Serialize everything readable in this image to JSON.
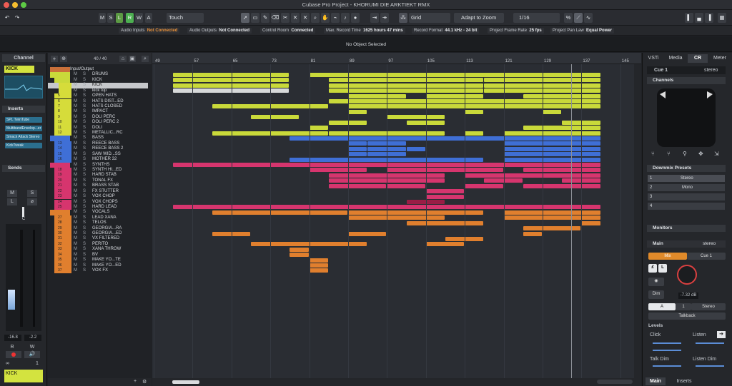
{
  "window": {
    "title": "Cubase Pro Project - KHORUMI DIE ARKTIEKT RMX"
  },
  "toolbar": {
    "m": "M",
    "s": "S",
    "l": "L",
    "r": "R",
    "w": "W",
    "a": "A",
    "automation_mode": "Touch",
    "snap_type": "Grid",
    "adapt_mode": "Adapt to Zoom",
    "quantize": "1/16"
  },
  "status": [
    {
      "label": "Audio Inputs",
      "value": "Not Connected",
      "warn": true
    },
    {
      "label": "Audio Outputs",
      "value": "Not Connected",
      "warn": false
    },
    {
      "label": "Control Room",
      "value": "Connected",
      "warn": false
    },
    {
      "label": "Max. Record Time",
      "value": "1625 hours 47 mins",
      "warn": false
    },
    {
      "label": "Record Format",
      "value": "44.1 kHz - 24 bit",
      "warn": false
    },
    {
      "label": "Project Frame Rate",
      "value": "25 fps",
      "warn": false
    },
    {
      "label": "Project Pan Law",
      "value": "Equal Power",
      "warn": false
    }
  ],
  "infoline": "No Object Selected",
  "inspector": {
    "tab": "Channel",
    "track_name": "KICK",
    "inserts_label": "Inserts",
    "inserts": [
      "SPL TwinTube",
      "MultibandEnvelop...er",
      "Smack Attack Stereo",
      "KickTweak"
    ],
    "sends_label": "Sends",
    "fader_value": "-16.8",
    "pan_value": "-2.2",
    "bottom_name": "KICK",
    "bottom_num": "1",
    "btn_m": "M",
    "btn_s": "S",
    "btn_l": "L",
    "btn_r": "R",
    "btn_w": "W",
    "pan_c": "C"
  },
  "tracklist": {
    "count": "40 / 40",
    "tracks": [
      {
        "name": "Input/Output",
        "num": "",
        "color": "#c9703a",
        "indent": 0,
        "folder": true,
        "ms": false
      },
      {
        "name": "DRUMS",
        "num": "",
        "color": "#c9d93a",
        "indent": 0,
        "folder": true,
        "ms": true
      },
      {
        "name": "KICK",
        "num": "",
        "color": "#c9d93a",
        "indent": 1,
        "folder": true,
        "ms": true
      },
      {
        "name": "KICK",
        "num": "",
        "color": "#d6dc3a",
        "indent": 2,
        "folder": false,
        "ms": true,
        "selected": true
      },
      {
        "name": "kick top",
        "num": "",
        "color": "#d6dc3a",
        "indent": 2,
        "folder": false,
        "ms": true
      },
      {
        "name": "OPEN HATS",
        "num": "5",
        "color": "#d6dc3a",
        "indent": 1,
        "folder": false,
        "ms": true
      },
      {
        "name": "HATS DIST...ED",
        "num": "6",
        "color": "#d6dc3a",
        "indent": 1,
        "folder": false,
        "ms": true
      },
      {
        "name": "HATS CLOSED",
        "num": "7",
        "color": "#d6dc3a",
        "indent": 1,
        "folder": false,
        "ms": true
      },
      {
        "name": "IMPACT",
        "num": "8",
        "color": "#d6dc3a",
        "indent": 1,
        "folder": false,
        "ms": true
      },
      {
        "name": "DOLI PERC",
        "num": "9",
        "color": "#d6dc3a",
        "indent": 1,
        "folder": false,
        "ms": true
      },
      {
        "name": "DOLI PERC 2",
        "num": "10",
        "color": "#d6dc3a",
        "indent": 1,
        "folder": false,
        "ms": true
      },
      {
        "name": "DOLI",
        "num": "11",
        "color": "#d6dc3a",
        "indent": 1,
        "folder": false,
        "ms": true
      },
      {
        "name": "METALLIC...RC",
        "num": "12",
        "color": "#d6dc3a",
        "indent": 1,
        "folder": false,
        "ms": true
      },
      {
        "name": "BASS",
        "num": "",
        "color": "#3f6fd6",
        "indent": 0,
        "folder": true,
        "ms": true
      },
      {
        "name": "REECE BASS",
        "num": "13",
        "color": "#3f6fd6",
        "indent": 1,
        "folder": false,
        "ms": true
      },
      {
        "name": "REECE BASS 2",
        "num": "14",
        "color": "#3f6fd6",
        "indent": 1,
        "folder": false,
        "ms": true
      },
      {
        "name": "SAW WID...SS",
        "num": "15",
        "color": "#3f6fd6",
        "indent": 1,
        "folder": false,
        "ms": true
      },
      {
        "name": "MOTHER 32",
        "num": "16",
        "color": "#3f6fd6",
        "indent": 1,
        "folder": false,
        "ms": true
      },
      {
        "name": "SYNTHS",
        "num": "",
        "color": "#d6356e",
        "indent": 0,
        "folder": true,
        "ms": true
      },
      {
        "name": "SYNTH HI...ED",
        "num": "18",
        "color": "#d6356e",
        "indent": 1,
        "folder": false,
        "ms": true
      },
      {
        "name": "HARD STAB",
        "num": "19",
        "color": "#d6356e",
        "indent": 1,
        "folder": false,
        "ms": true
      },
      {
        "name": "TONAL FX",
        "num": "20",
        "color": "#d6356e",
        "indent": 1,
        "folder": false,
        "ms": true
      },
      {
        "name": "BRASS STAB",
        "num": "21",
        "color": "#d6356e",
        "indent": 1,
        "folder": false,
        "ms": true
      },
      {
        "name": "FX STUTTER",
        "num": "22",
        "color": "#d6356e",
        "indent": 1,
        "folder": false,
        "ms": true
      },
      {
        "name": "VOX CHOP",
        "num": "23",
        "color": "#d6356e",
        "indent": 1,
        "folder": false,
        "ms": true
      },
      {
        "name": "VOX CHOPS",
        "num": "24",
        "color": "#d6356e",
        "indent": 1,
        "folder": false,
        "ms": true
      },
      {
        "name": "HARD LEAD",
        "num": "25",
        "color": "#d6356e",
        "indent": 1,
        "folder": false,
        "ms": true
      },
      {
        "name": "VOCALS",
        "num": "",
        "color": "#e07f2e",
        "indent": 0,
        "folder": true,
        "ms": true
      },
      {
        "name": "LEAD XANA",
        "num": "27",
        "color": "#e07f2e",
        "indent": 1,
        "folder": false,
        "ms": true
      },
      {
        "name": "TELOS",
        "num": "28",
        "color": "#e07f2e",
        "indent": 1,
        "folder": false,
        "ms": true
      },
      {
        "name": "GEORGIA...RA",
        "num": "29",
        "color": "#e07f2e",
        "indent": 1,
        "folder": false,
        "ms": true
      },
      {
        "name": "GEORGIA...ED",
        "num": "30",
        "color": "#e07f2e",
        "indent": 1,
        "folder": false,
        "ms": true
      },
      {
        "name": "VX FILTERED",
        "num": "31",
        "color": "#e07f2e",
        "indent": 1,
        "folder": false,
        "ms": true
      },
      {
        "name": "PERITO",
        "num": "32",
        "color": "#e07f2e",
        "indent": 1,
        "folder": false,
        "ms": true
      },
      {
        "name": "XANA THROW",
        "num": "33",
        "color": "#e07f2e",
        "indent": 1,
        "folder": false,
        "ms": true
      },
      {
        "name": "BV",
        "num": "34",
        "color": "#e07f2e",
        "indent": 1,
        "folder": false,
        "ms": true
      },
      {
        "name": "MAKE YO...TE",
        "num": "35",
        "color": "#e07f2e",
        "indent": 1,
        "folder": false,
        "ms": true
      },
      {
        "name": "MAKE YO...ED",
        "num": "36",
        "color": "#e07f2e",
        "indent": 1,
        "folder": false,
        "ms": true
      },
      {
        "name": "VOX FX",
        "num": "37",
        "color": "#e07f2e",
        "indent": 1,
        "folder": false,
        "ms": true
      }
    ]
  },
  "ruler": {
    "bars": [
      "49",
      "57",
      "65",
      "73",
      "81",
      "89",
      "97",
      "105",
      "113",
      "121",
      "129",
      "137",
      "145"
    ]
  },
  "clips": [
    {
      "row": 1,
      "bar": 53,
      "len": 24,
      "c": "#c9d93a"
    },
    {
      "row": 1,
      "bar": 81,
      "len": 60,
      "c": "#c9d93a"
    },
    {
      "row": 2,
      "bar": 53,
      "len": 24,
      "c": "#c9d93a"
    },
    {
      "row": 2,
      "bar": 85,
      "len": 32,
      "c": "#c9d93a"
    },
    {
      "row": 2,
      "bar": 117,
      "len": 24,
      "c": "#c9d93a"
    },
    {
      "row": 3,
      "bar": 53,
      "len": 24,
      "c": "#c9d93a"
    },
    {
      "row": 3,
      "bar": 85,
      "len": 32,
      "c": "#c9d93a"
    },
    {
      "row": 3,
      "bar": 117,
      "len": 24,
      "c": "#c9d93a"
    },
    {
      "row": 4,
      "bar": 53,
      "len": 24,
      "c": "#d7d9da"
    },
    {
      "row": 4,
      "bar": 85,
      "len": 32,
      "c": "#c9d93a"
    },
    {
      "row": 4,
      "bar": 117,
      "len": 24,
      "c": "#c9d93a"
    },
    {
      "row": 5,
      "bar": 89,
      "len": 12,
      "c": "#c9d93a"
    },
    {
      "row": 5,
      "bar": 105,
      "len": 12,
      "c": "#c9d93a"
    },
    {
      "row": 5,
      "bar": 125,
      "len": 16,
      "c": "#c9d93a"
    },
    {
      "row": 6,
      "bar": 85,
      "len": 56,
      "c": "#c9d93a"
    },
    {
      "row": 7,
      "bar": 61,
      "len": 24,
      "c": "#c9d93a"
    },
    {
      "row": 7,
      "bar": 89,
      "len": 52,
      "c": "#c9d93a"
    },
    {
      "row": 8,
      "bar": 89,
      "len": 4,
      "c": "#c9d93a"
    },
    {
      "row": 8,
      "bar": 113,
      "len": 4,
      "c": "#c9d93a"
    },
    {
      "row": 8,
      "bar": 129,
      "len": 4,
      "c": "#c9d93a"
    },
    {
      "row": 9,
      "bar": 69,
      "len": 10,
      "c": "#c9d93a"
    },
    {
      "row": 9,
      "bar": 97,
      "len": 12,
      "c": "#c9d93a"
    },
    {
      "row": 10,
      "bar": 85,
      "len": 8,
      "c": "#c9d93a"
    },
    {
      "row": 10,
      "bar": 101,
      "len": 8,
      "c": "#c9d93a"
    },
    {
      "row": 10,
      "bar": 133,
      "len": 8,
      "c": "#c9d93a"
    },
    {
      "row": 11,
      "bar": 81,
      "len": 4,
      "c": "#c9d93a"
    },
    {
      "row": 11,
      "bar": 125,
      "len": 16,
      "c": "#c9d93a"
    },
    {
      "row": 12,
      "bar": 61,
      "len": 24,
      "c": "#c9d93a"
    },
    {
      "row": 12,
      "bar": 85,
      "len": 24,
      "c": "#c9d93a"
    },
    {
      "row": 12,
      "bar": 113,
      "len": 4,
      "c": "#c9d93a"
    },
    {
      "row": 12,
      "bar": 121,
      "len": 20,
      "c": "#c9d93a"
    },
    {
      "row": 13,
      "bar": 77,
      "len": 64,
      "c": "#3f6fd6"
    },
    {
      "row": 14,
      "bar": 89,
      "len": 4,
      "c": "#3f6fd6"
    },
    {
      "row": 14,
      "bar": 93,
      "len": 8,
      "c": "#3f6fd6"
    },
    {
      "row": 14,
      "bar": 121,
      "len": 20,
      "c": "#3f6fd6"
    },
    {
      "row": 15,
      "bar": 89,
      "len": 4,
      "c": "#3f6fd6"
    },
    {
      "row": 15,
      "bar": 93,
      "len": 8,
      "c": "#3f6fd6"
    },
    {
      "row": 15,
      "bar": 101,
      "len": 4,
      "c": "#3f6fd6"
    },
    {
      "row": 15,
      "bar": 121,
      "len": 20,
      "c": "#3f6fd6"
    },
    {
      "row": 16,
      "bar": 89,
      "len": 4,
      "c": "#3f6fd6"
    },
    {
      "row": 16,
      "bar": 93,
      "len": 8,
      "c": "#3f6fd6"
    },
    {
      "row": 16,
      "bar": 121,
      "len": 20,
      "c": "#3f6fd6"
    },
    {
      "row": 17,
      "bar": 77,
      "len": 40,
      "c": "#3f6fd6"
    },
    {
      "row": 17,
      "bar": 121,
      "len": 20,
      "c": "#3f6fd6"
    },
    {
      "row": 18,
      "bar": 53,
      "len": 88,
      "c": "#d6356e"
    },
    {
      "row": 19,
      "bar": 81,
      "len": 12,
      "c": "#d6356e"
    },
    {
      "row": 19,
      "bar": 97,
      "len": 24,
      "c": "#d6356e"
    },
    {
      "row": 19,
      "bar": 125,
      "len": 16,
      "c": "#d6356e"
    },
    {
      "row": 20,
      "bar": 85,
      "len": 24,
      "c": "#d6356e"
    },
    {
      "row": 20,
      "bar": 113,
      "len": 28,
      "c": "#d6356e"
    },
    {
      "row": 21,
      "bar": 85,
      "len": 24,
      "c": "#d6356e"
    },
    {
      "row": 21,
      "bar": 117,
      "len": 8,
      "c": "#d6356e"
    },
    {
      "row": 21,
      "bar": 133,
      "len": 8,
      "c": "#d6356e"
    },
    {
      "row": 22,
      "bar": 85,
      "len": 12,
      "c": "#d6356e"
    },
    {
      "row": 22,
      "bar": 97,
      "len": 8,
      "c": "#d6356e"
    },
    {
      "row": 22,
      "bar": 113,
      "len": 8,
      "c": "#d6356e"
    },
    {
      "row": 22,
      "bar": 125,
      "len": 16,
      "c": "#d6356e"
    },
    {
      "row": 23,
      "bar": 105,
      "len": 8,
      "c": "#d6356e"
    },
    {
      "row": 24,
      "bar": 105,
      "len": 8,
      "c": "#d6356e"
    },
    {
      "row": 25,
      "bar": 101,
      "len": 8,
      "c": "#9a1d45"
    },
    {
      "row": 26,
      "bar": 53,
      "len": 88,
      "c": "#d6356e"
    },
    {
      "row": 27,
      "bar": 61,
      "len": 28,
      "c": "#e07f2e"
    },
    {
      "row": 27,
      "bar": 89,
      "len": 28,
      "c": "#e07f2e"
    },
    {
      "row": 27,
      "bar": 121,
      "len": 20,
      "c": "#e07f2e"
    },
    {
      "row": 28,
      "bar": 89,
      "len": 20,
      "c": "#e07f2e"
    },
    {
      "row": 28,
      "bar": 121,
      "len": 20,
      "c": "#e07f2e"
    },
    {
      "row": 29,
      "bar": 101,
      "len": 16,
      "c": "#e07f2e"
    },
    {
      "row": 29,
      "bar": 137,
      "len": 4,
      "c": "#e07f2e"
    },
    {
      "row": 30,
      "bar": 125,
      "len": 12,
      "c": "#e07f2e"
    },
    {
      "row": 31,
      "bar": 61,
      "len": 8,
      "c": "#e07f2e"
    },
    {
      "row": 31,
      "bar": 89,
      "len": 8,
      "c": "#e07f2e"
    },
    {
      "row": 31,
      "bar": 125,
      "len": 4,
      "c": "#e07f2e"
    },
    {
      "row": 32,
      "bar": 109,
      "len": 8,
      "c": "#e07f2e"
    },
    {
      "row": 33,
      "bar": 69,
      "len": 24,
      "c": "#e07f2e"
    },
    {
      "row": 33,
      "bar": 105,
      "len": 8,
      "c": "#e07f2e"
    },
    {
      "row": 34,
      "bar": 77,
      "len": 4,
      "c": "#e07f2e"
    },
    {
      "row": 35,
      "bar": 77,
      "len": 4,
      "c": "#e07f2e"
    },
    {
      "row": 36,
      "bar": 81,
      "len": 4,
      "c": "#e07f2e"
    },
    {
      "row": 37,
      "bar": 81,
      "len": 4,
      "c": "#e07f2e"
    },
    {
      "row": 38,
      "bar": 81,
      "len": 4,
      "c": "#e07f2e"
    }
  ],
  "rightzone": {
    "tabs": [
      "VSTi",
      "Media",
      "CR",
      "Meter"
    ],
    "active_tab": "CR",
    "cue_label": "Cue 1",
    "cue_format": "stereo",
    "channels_label": "Channels",
    "downmix_label": "Downmix Presets",
    "downmix": [
      {
        "num": "1",
        "name": "Stereo"
      },
      {
        "num": "2",
        "name": "Mono"
      },
      {
        "num": "3",
        "name": ""
      },
      {
        "num": "4",
        "name": ""
      }
    ],
    "monitors_label": "Monitors",
    "main_label": "Main",
    "main_format": "stereo",
    "mix_label": "Mix",
    "cue_btn": "Cue 1",
    "dim_label": "Dim",
    "level_value": "-7.32 dB",
    "a_label": "A",
    "one_label": "1",
    "stereo_label": "Stereo",
    "talkback_label": "Talkback",
    "levels_label": "Levels",
    "click_label": "Click",
    "listen_label": "Listen",
    "talkdim_label": "Talk Dim",
    "listendim_label": "Listen Dim",
    "bottom_tabs": [
      "Main",
      "Inserts"
    ]
  }
}
